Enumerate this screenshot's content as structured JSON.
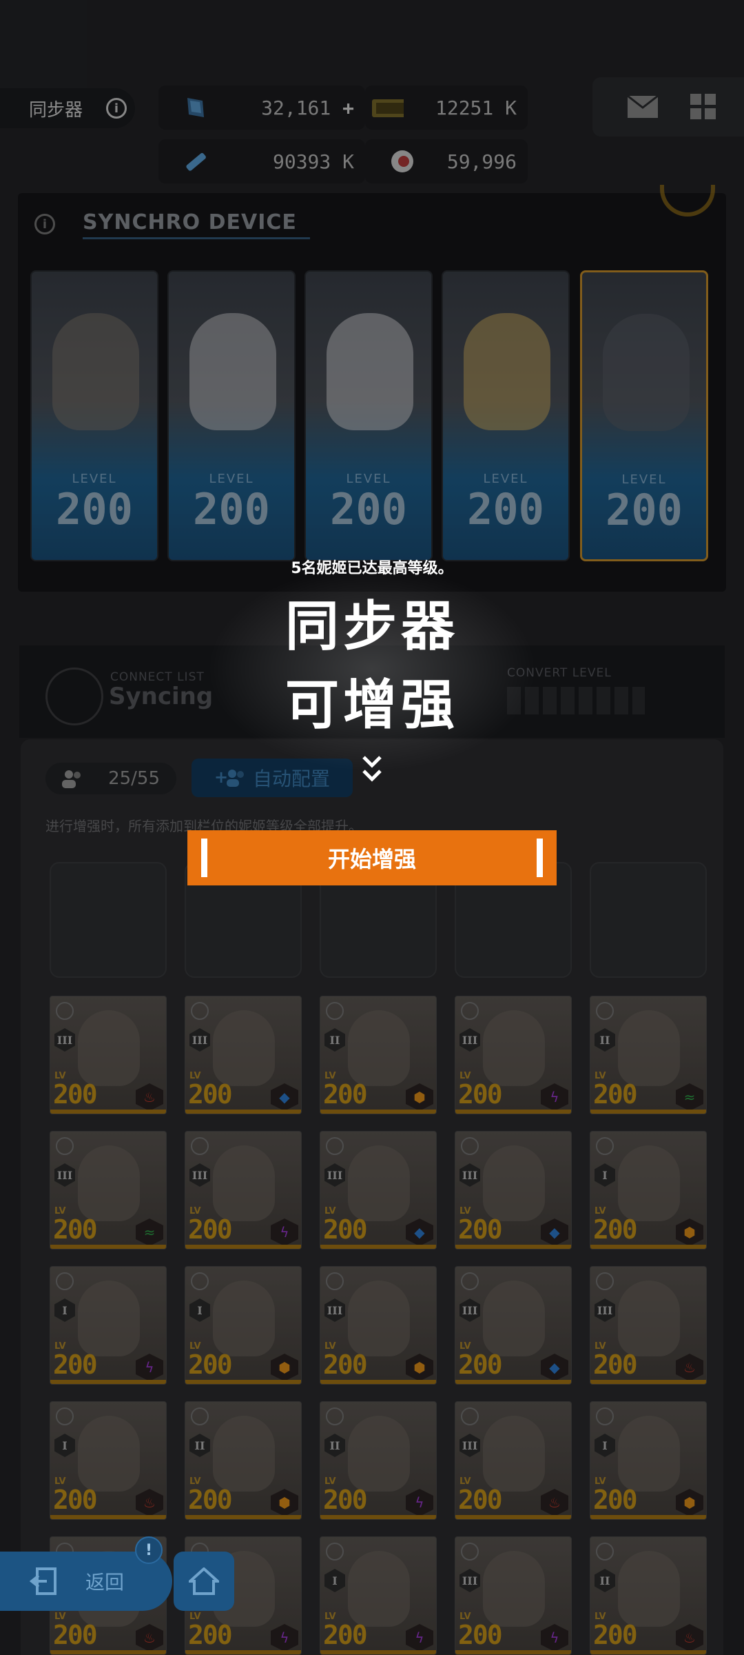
{
  "header": {
    "title": "同步器",
    "resources": [
      {
        "name": "blue-crystal-icon",
        "value": "32,161",
        "plus": "+"
      },
      {
        "name": "credit-case-icon",
        "value": "12251 K"
      },
      {
        "name": "battle-data-icon",
        "value": "90393 K"
      },
      {
        "name": "core-dust-icon",
        "value": "59,996"
      }
    ]
  },
  "device": {
    "title": "SYNCHRO DEVICE",
    "level_label": "LEVEL",
    "cards": [
      {
        "level": "200",
        "highlight": false
      },
      {
        "level": "200",
        "highlight": false
      },
      {
        "level": "200",
        "highlight": false
      },
      {
        "level": "200",
        "highlight": false
      },
      {
        "level": "200",
        "highlight": true
      }
    ]
  },
  "strip": {
    "connect_label": "CONNECT LIST",
    "connect_value": "Syncing",
    "convert_label": "CONVERT LEVEL"
  },
  "slots_panel": {
    "count": "25/55",
    "auto_button": "自动配置",
    "hint": "进行增强时，所有添加到栏位的妮姬等级全部提升。"
  },
  "tiles": [
    {
      "rank": "III",
      "level": "200",
      "element": "fire",
      "color": "#c0392b"
    },
    {
      "rank": "III",
      "level": "200",
      "element": "water",
      "color": "#2d7bd0"
    },
    {
      "rank": "II",
      "level": "200",
      "element": "iron",
      "color": "#e0901a"
    },
    {
      "rank": "III",
      "level": "200",
      "element": "electric",
      "color": "#9b39d0"
    },
    {
      "rank": "II",
      "level": "200",
      "element": "wind",
      "color": "#2ea84a"
    },
    {
      "rank": "III",
      "level": "200",
      "element": "wind",
      "color": "#2ea84a"
    },
    {
      "rank": "III",
      "level": "200",
      "element": "electric",
      "color": "#9b39d0"
    },
    {
      "rank": "III",
      "level": "200",
      "element": "water",
      "color": "#2d7bd0"
    },
    {
      "rank": "III",
      "level": "200",
      "element": "water",
      "color": "#2d7bd0"
    },
    {
      "rank": "I",
      "level": "200",
      "element": "iron",
      "color": "#e0901a"
    },
    {
      "rank": "I",
      "level": "200",
      "element": "electric",
      "color": "#9b39d0"
    },
    {
      "rank": "I",
      "level": "200",
      "element": "iron",
      "color": "#e0901a"
    },
    {
      "rank": "III",
      "level": "200",
      "element": "iron",
      "color": "#e0901a"
    },
    {
      "rank": "III",
      "level": "200",
      "element": "water",
      "color": "#2d7bd0"
    },
    {
      "rank": "III",
      "level": "200",
      "element": "fire",
      "color": "#c0392b"
    },
    {
      "rank": "I",
      "level": "200",
      "element": "fire",
      "color": "#c0392b"
    },
    {
      "rank": "II",
      "level": "200",
      "element": "iron",
      "color": "#e0901a"
    },
    {
      "rank": "II",
      "level": "200",
      "element": "electric",
      "color": "#9b39d0"
    },
    {
      "rank": "III",
      "level": "200",
      "element": "fire",
      "color": "#c0392b"
    },
    {
      "rank": "I",
      "level": "200",
      "element": "iron",
      "color": "#e0901a"
    },
    {
      "rank": "",
      "level": "200",
      "element": "fire",
      "color": "#c0392b"
    },
    {
      "rank": "",
      "level": "200",
      "element": "electric",
      "color": "#9b39d0"
    },
    {
      "rank": "I",
      "level": "200",
      "element": "electric",
      "color": "#9b39d0"
    },
    {
      "rank": "III",
      "level": "200",
      "element": "electric",
      "color": "#9b39d0"
    },
    {
      "rank": "II",
      "level": "200",
      "element": "fire",
      "color": "#c0392b"
    }
  ],
  "tile_lv_label": "LV",
  "overlay": {
    "notice": "5名妮姬已达最高等级。",
    "line1": "同步器",
    "line2": "可增强",
    "start_button": "开始增强"
  },
  "nav": {
    "back_label": "返回",
    "alert": "!"
  },
  "colors": {
    "accent_orange": "#e8720f",
    "card_blue": "#1e5f8d",
    "level_gold": "#c8951a"
  }
}
